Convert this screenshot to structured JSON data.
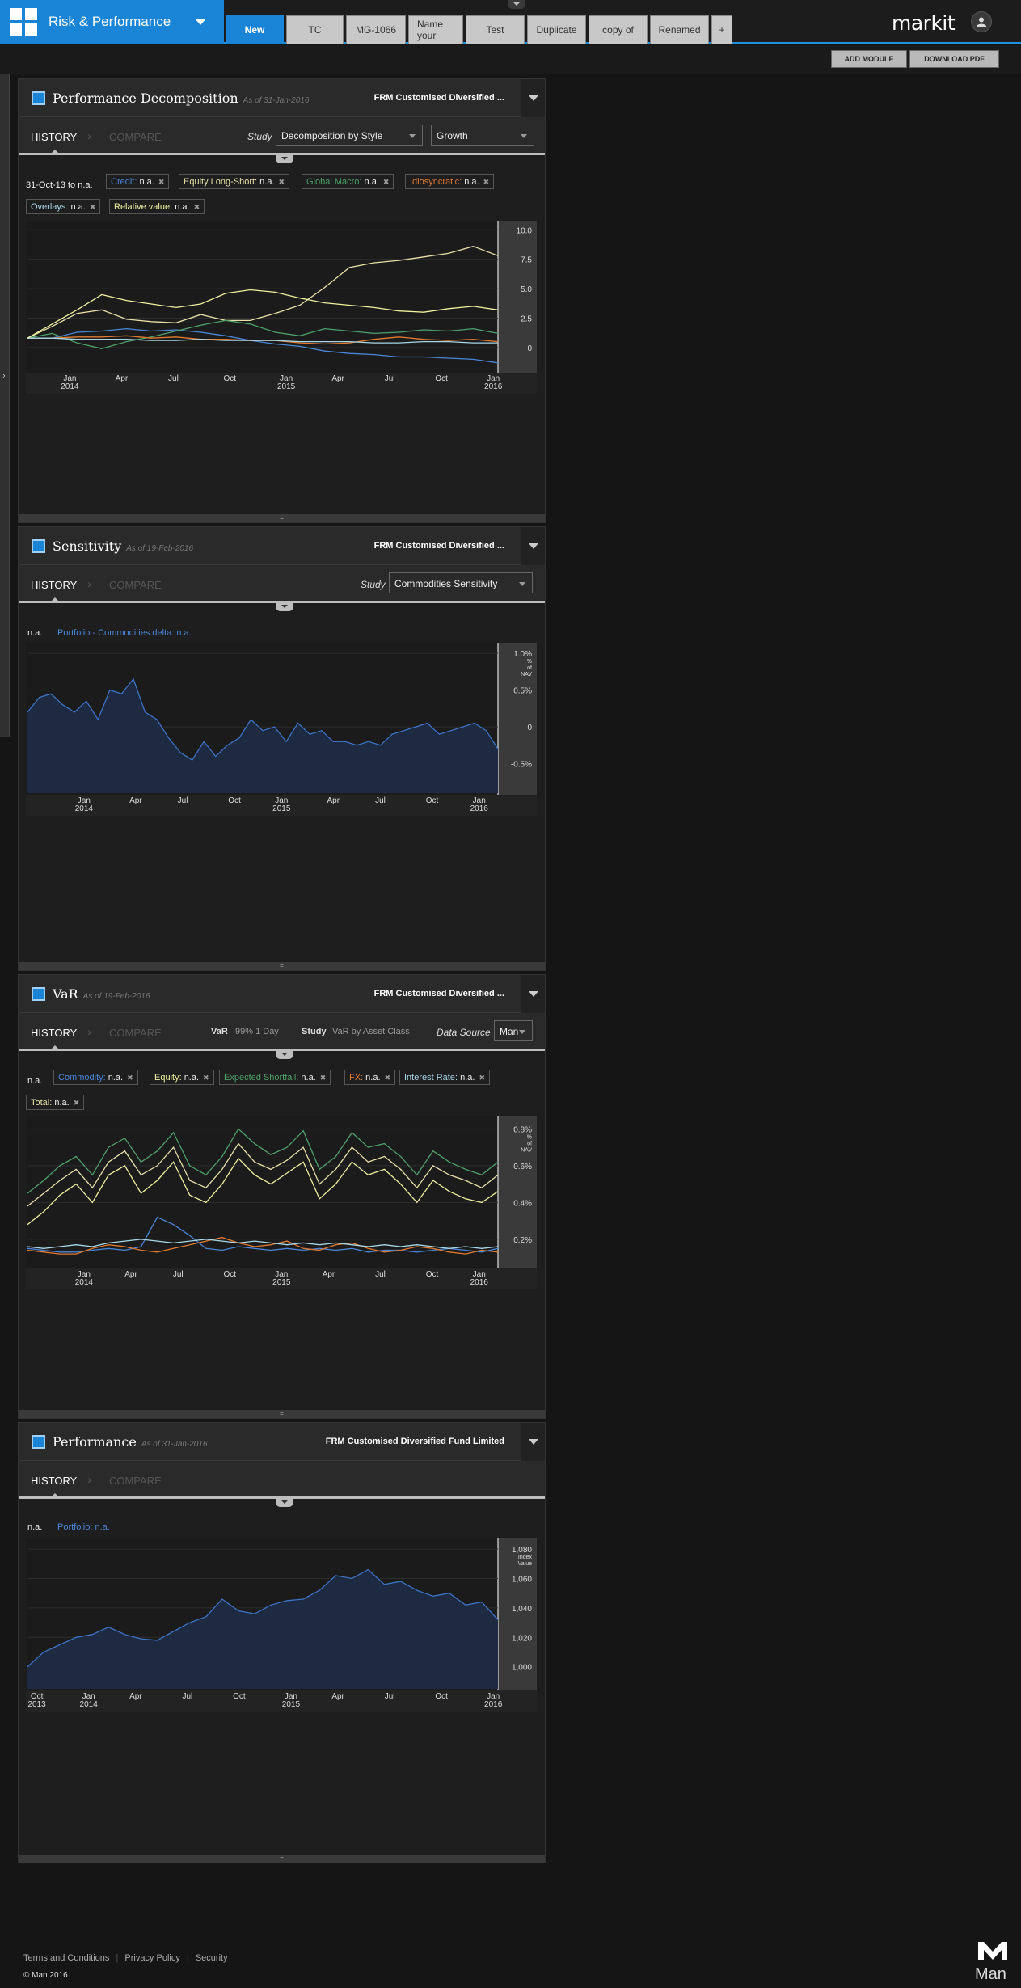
{
  "app": {
    "title": "Risk & Performance",
    "brand": "markit"
  },
  "tabs": [
    "New",
    "TC",
    "MG-1066",
    "Name your",
    "Test",
    "Duplicate",
    "copy of",
    "Renamed",
    "+"
  ],
  "toolbar": {
    "add_module": "ADD MODULE",
    "download_pdf": "DOWNLOAD PDF"
  },
  "common": {
    "history": "HISTORY",
    "compare": "COMPARE",
    "na": "n.a."
  },
  "modules": {
    "perfdecomp": {
      "title": "Performance Decomposition",
      "asof": "As of 31-Jan-2016",
      "fund": "FRM Customised Diversified ...",
      "study_label": "Study",
      "study": "Decomposition by Style",
      "mode": "Growth",
      "range": "31-Oct-13 to n.a.",
      "chips": [
        {
          "name": "Credit:",
          "val": "n.a.",
          "color": "#4a86d8"
        },
        {
          "name": "Equity Long-Short:",
          "val": "n.a.",
          "color": "#e8e0a8"
        },
        {
          "name": "Global Macro:",
          "val": "n.a.",
          "color": "#4da06a"
        },
        {
          "name": "Idiosyncratic:",
          "val": "n.a.",
          "color": "#e07a30"
        },
        {
          "name": "Overlays:",
          "val": "n.a.",
          "color": "#a8d8e8"
        },
        {
          "name": "Relative value:",
          "val": "n.a.",
          "color": "#f0f0a0"
        }
      ]
    },
    "sensitivity": {
      "title": "Sensitivity",
      "asof": "As of 19-Feb-2016",
      "fund": "FRM Customised Diversified ...",
      "study_label": "Study",
      "study": "Commodities Sensitivity",
      "legend_na": "n.a.",
      "legend_series": "Portfolio - Commodities delta:",
      "legend_val": "n.a."
    },
    "var": {
      "title": "VaR",
      "asof": "As of 19-Feb-2016",
      "fund": "FRM Customised Diversified ...",
      "var_label": "VaR",
      "var_value": "99% 1 Day",
      "study_label": "Study",
      "study": "VaR by Asset Class",
      "ds_label": "Data Source",
      "ds": "Man",
      "chips": [
        {
          "name": "Commodity:",
          "val": "n.a.",
          "color": "#4a86d8"
        },
        {
          "name": "Equity:",
          "val": "n.a.",
          "color": "#f0f0a0"
        },
        {
          "name": "Expected Shortfall:",
          "val": "n.a.",
          "color": "#4da06a"
        },
        {
          "name": "FX:",
          "val": "n.a.",
          "color": "#e07a30"
        },
        {
          "name": "Interest Rate:",
          "val": "n.a.",
          "color": "#a8d8e8"
        },
        {
          "name": "Total:",
          "val": "n.a.",
          "color": "#e8e0a8"
        }
      ]
    },
    "performance": {
      "title": "Performance",
      "asof": "As of 31-Jan-2016",
      "fund": "FRM Customised Diversified Fund Limited",
      "legend_na": "n.a.",
      "legend_series": "Portfolio:",
      "legend_val": "n.a."
    }
  },
  "chart_data": [
    {
      "type": "line",
      "y_ticks": [
        "10.0",
        "7.5",
        "5.0",
        "2.5",
        "0"
      ],
      "ylim": [
        -2,
        10.5
      ],
      "x_ticks": [
        [
          "Jan",
          "2014"
        ],
        [
          "Apr",
          ""
        ],
        [
          "Jul",
          ""
        ],
        [
          "Oct",
          ""
        ],
        [
          "Jan",
          "2015"
        ],
        [
          "Apr",
          ""
        ],
        [
          "Jul",
          ""
        ],
        [
          "Oct",
          ""
        ],
        [
          "Jan",
          "2016"
        ]
      ],
      "x_tick_pos": [
        0.09,
        0.2,
        0.31,
        0.43,
        0.55,
        0.66,
        0.77,
        0.88,
        0.99
      ],
      "series": [
        {
          "color": "#4a86d8",
          "values": [
            0.8,
            0.8,
            1.3,
            1.4,
            1.6,
            1.4,
            1.5,
            1.3,
            1.0,
            0.6,
            0.3,
            0.1,
            -0.3,
            -0.5,
            -0.6,
            -0.8,
            -0.8,
            -0.9,
            -1.0,
            -1.3
          ]
        },
        {
          "color": "#e8e0a8",
          "values": [
            0.8,
            1.8,
            2.9,
            3.2,
            2.4,
            2.2,
            2.1,
            2.8,
            2.3,
            2.3,
            2.9,
            3.6,
            5.1,
            6.8,
            7.2,
            7.4,
            7.7,
            8.0,
            8.6,
            7.8
          ]
        },
        {
          "color": "#4da06a",
          "values": [
            0.8,
            1.2,
            0.4,
            -0.1,
            0.5,
            0.9,
            1.4,
            1.9,
            2.3,
            2.0,
            1.3,
            1.0,
            1.6,
            1.4,
            1.2,
            1.3,
            1.5,
            1.4,
            1.6,
            1.2
          ]
        },
        {
          "color": "#e07a30",
          "values": [
            0.8,
            0.8,
            0.9,
            0.9,
            1.0,
            0.8,
            0.9,
            0.7,
            0.7,
            0.6,
            0.6,
            0.4,
            0.3,
            0.4,
            0.7,
            0.9,
            0.7,
            0.6,
            0.7,
            0.5
          ]
        },
        {
          "color": "#a8d8e8",
          "values": [
            0.8,
            0.8,
            0.7,
            0.7,
            0.7,
            0.6,
            0.6,
            0.7,
            0.6,
            0.6,
            0.6,
            0.5,
            0.5,
            0.5,
            0.4,
            0.4,
            0.5,
            0.5,
            0.4,
            0.4
          ]
        },
        {
          "color": "#f0f0a0",
          "values": [
            0.8,
            2.0,
            3.2,
            4.5,
            4.0,
            3.7,
            3.4,
            3.7,
            4.6,
            4.9,
            4.7,
            4.2,
            3.8,
            3.6,
            3.4,
            3.1,
            3.0,
            3.3,
            3.5,
            3.2
          ]
        }
      ]
    },
    {
      "type": "area",
      "y_ticks": [
        "1.0%",
        "0.5%",
        "0",
        "-0.5%"
      ],
      "ylim": [
        -0.9,
        1.1
      ],
      "y_unit": "% of NAV",
      "x_ticks": [
        [
          "Jan",
          "2014"
        ],
        [
          "Apr",
          ""
        ],
        [
          "Jul",
          ""
        ],
        [
          "Oct",
          ""
        ],
        [
          "Jan",
          "2015"
        ],
        [
          "Apr",
          ""
        ],
        [
          "Jul",
          ""
        ],
        [
          "Oct",
          ""
        ],
        [
          "Jan",
          "2016"
        ]
      ],
      "x_tick_pos": [
        0.12,
        0.23,
        0.33,
        0.44,
        0.54,
        0.65,
        0.75,
        0.86,
        0.96
      ],
      "series": [
        {
          "name": "Portfolio - Commodities delta",
          "color": "#3d72c4",
          "values": [
            0.2,
            0.4,
            0.45,
            0.3,
            0.2,
            0.35,
            0.1,
            0.5,
            0.45,
            0.65,
            0.2,
            0.1,
            -0.15,
            -0.35,
            -0.45,
            -0.2,
            -0.4,
            -0.25,
            -0.15,
            0.1,
            -0.05,
            0.0,
            -0.2,
            0.05,
            -0.1,
            -0.05,
            -0.2,
            -0.2,
            -0.25,
            -0.2,
            -0.25,
            -0.1,
            -0.05,
            0.0,
            0.05,
            -0.1,
            -0.05,
            0.0,
            0.05,
            -0.05,
            -0.3
          ]
        }
      ]
    },
    {
      "type": "line",
      "y_ticks": [
        "0.8%",
        "0.6%",
        "0.4%",
        "0.2%"
      ],
      "ylim": [
        0.05,
        0.85
      ],
      "y_unit": "% of NAV",
      "x_ticks": [
        [
          "Jan",
          "2014"
        ],
        [
          "Apr",
          ""
        ],
        [
          "Jul",
          ""
        ],
        [
          "Oct",
          ""
        ],
        [
          "Jan",
          "2015"
        ],
        [
          "Apr",
          ""
        ],
        [
          "Jul",
          ""
        ],
        [
          "Oct",
          ""
        ],
        [
          "Jan",
          "2016"
        ]
      ],
      "x_tick_pos": [
        0.12,
        0.22,
        0.32,
        0.43,
        0.54,
        0.64,
        0.75,
        0.86,
        0.96
      ],
      "series": [
        {
          "color": "#4da06a",
          "values": [
            0.45,
            0.52,
            0.6,
            0.65,
            0.55,
            0.7,
            0.75,
            0.62,
            0.68,
            0.78,
            0.6,
            0.55,
            0.65,
            0.8,
            0.72,
            0.66,
            0.7,
            0.79,
            0.58,
            0.65,
            0.78,
            0.7,
            0.72,
            0.65,
            0.55,
            0.68,
            0.62,
            0.58,
            0.55,
            0.62
          ]
        },
        {
          "color": "#e8e0a8",
          "values": [
            0.38,
            0.45,
            0.52,
            0.58,
            0.48,
            0.62,
            0.68,
            0.55,
            0.6,
            0.7,
            0.52,
            0.48,
            0.58,
            0.72,
            0.62,
            0.58,
            0.63,
            0.7,
            0.5,
            0.58,
            0.7,
            0.62,
            0.65,
            0.58,
            0.48,
            0.6,
            0.55,
            0.52,
            0.48,
            0.55
          ]
        },
        {
          "color": "#f0f0a0",
          "values": [
            0.28,
            0.35,
            0.44,
            0.5,
            0.4,
            0.55,
            0.6,
            0.45,
            0.52,
            0.62,
            0.44,
            0.4,
            0.5,
            0.64,
            0.55,
            0.5,
            0.56,
            0.62,
            0.42,
            0.5,
            0.62,
            0.55,
            0.58,
            0.5,
            0.4,
            0.52,
            0.46,
            0.42,
            0.4,
            0.46
          ]
        },
        {
          "color": "#4a86d8",
          "values": [
            0.15,
            0.14,
            0.13,
            0.13,
            0.14,
            0.15,
            0.14,
            0.16,
            0.32,
            0.28,
            0.22,
            0.15,
            0.14,
            0.16,
            0.15,
            0.14,
            0.15,
            0.14,
            0.15,
            0.14,
            0.15,
            0.13,
            0.14,
            0.14,
            0.13,
            0.14,
            0.15,
            0.14,
            0.13,
            0.15
          ]
        },
        {
          "color": "#e07a30",
          "values": [
            0.14,
            0.13,
            0.12,
            0.12,
            0.15,
            0.17,
            0.16,
            0.14,
            0.13,
            0.15,
            0.17,
            0.19,
            0.21,
            0.18,
            0.16,
            0.17,
            0.19,
            0.15,
            0.14,
            0.17,
            0.18,
            0.15,
            0.13,
            0.14,
            0.16,
            0.15,
            0.13,
            0.12,
            0.14,
            0.13
          ]
        },
        {
          "color": "#a8d8e8",
          "values": [
            0.16,
            0.15,
            0.16,
            0.17,
            0.16,
            0.18,
            0.19,
            0.2,
            0.19,
            0.18,
            0.19,
            0.2,
            0.19,
            0.18,
            0.19,
            0.18,
            0.17,
            0.18,
            0.17,
            0.18,
            0.17,
            0.16,
            0.17,
            0.16,
            0.17,
            0.16,
            0.15,
            0.16,
            0.15,
            0.16
          ]
        }
      ]
    },
    {
      "type": "area",
      "y_ticks": [
        "1,080",
        "1,060",
        "1,040",
        "1,020",
        "1,000"
      ],
      "ylim": [
        985,
        1085
      ],
      "y_unit": "Index Value",
      "x_ticks": [
        [
          "Oct",
          "2013"
        ],
        [
          "Jan",
          "2014"
        ],
        [
          "Apr",
          ""
        ],
        [
          "Jul",
          ""
        ],
        [
          "Oct",
          ""
        ],
        [
          "Jan",
          "2015"
        ],
        [
          "Apr",
          ""
        ],
        [
          "Jul",
          ""
        ],
        [
          "Oct",
          ""
        ],
        [
          "Jan",
          "2016"
        ]
      ],
      "x_tick_pos": [
        0.02,
        0.13,
        0.23,
        0.34,
        0.45,
        0.56,
        0.66,
        0.77,
        0.88,
        0.99
      ],
      "series": [
        {
          "name": "Portfolio",
          "color": "#3d72c4",
          "values": [
            1000,
            1010,
            1015,
            1020,
            1022,
            1027,
            1022,
            1019,
            1018,
            1024,
            1030,
            1034,
            1046,
            1038,
            1036,
            1042,
            1045,
            1046,
            1052,
            1062,
            1060,
            1066,
            1056,
            1058,
            1052,
            1048,
            1050,
            1042,
            1044,
            1032
          ]
        }
      ]
    }
  ]
}
